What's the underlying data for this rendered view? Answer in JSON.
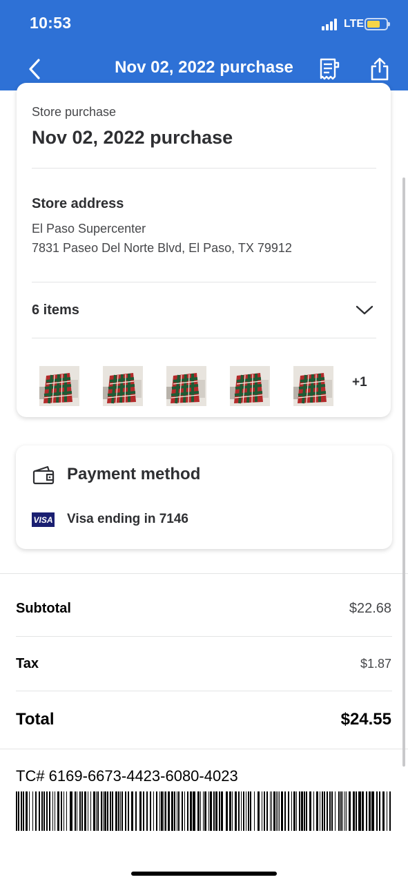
{
  "status_bar": {
    "time": "10:53",
    "network": "LTE"
  },
  "nav": {
    "title": "Nov 02, 2022 purchase",
    "back_icon": "chevron-left-icon",
    "receipt_icon": "receipt-icon",
    "share_icon": "share-icon"
  },
  "purchase": {
    "type_label": "Store purchase",
    "title": "Nov 02, 2022 purchase",
    "address_heading": "Store address",
    "store_name": "El Paso Supercenter",
    "store_street": "7831 Paseo Del Norte Blvd, El Paso, TX 79912",
    "items_label": "6 items",
    "more_items": "+1"
  },
  "payment": {
    "heading": "Payment method",
    "card_brand": "VISA",
    "card_text": "Visa ending in 7146"
  },
  "summary": {
    "subtotal_label": "Subtotal",
    "subtotal_value": "$22.68",
    "tax_label": "Tax",
    "tax_value": "$1.87",
    "total_label": "Total",
    "total_value": "$24.55"
  },
  "receipt": {
    "tc_number": "TC# 6169-6673-4423-6080-4023"
  },
  "colors": {
    "brand_blue": "#2e71d6",
    "visa_navy": "#1a1f71",
    "battery_yellow": "#f5d547"
  }
}
